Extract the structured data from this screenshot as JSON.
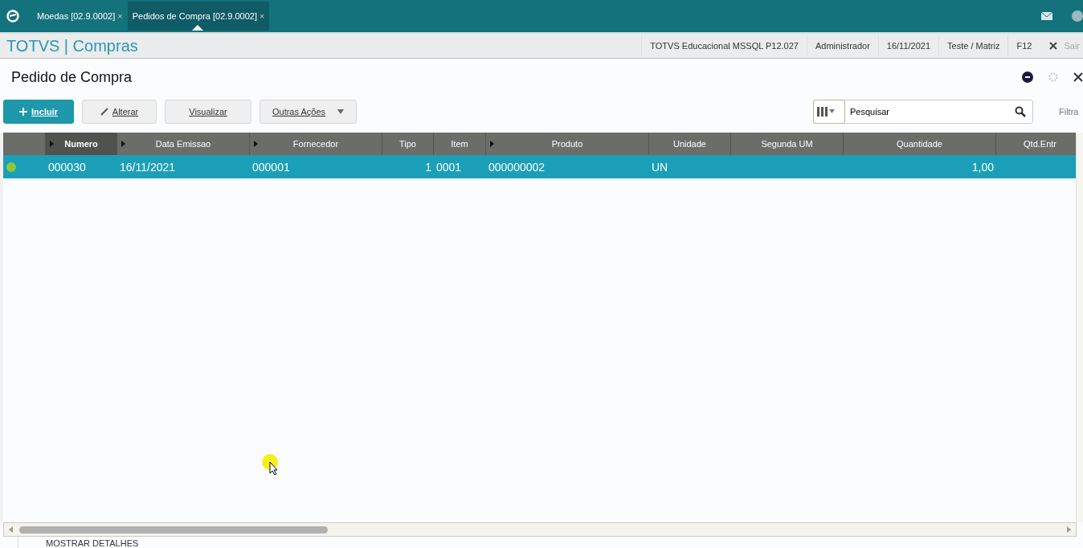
{
  "tabs": [
    {
      "label": "Moedas [02.9.0002]",
      "close": "×",
      "selected": false
    },
    {
      "label": "Pedidos de Compra [02.9.0002]",
      "close": "×",
      "selected": true
    }
  ],
  "header": {
    "brand": "TOTVS | Compras",
    "info": [
      "TOTVS Educacional MSSQL P12.027",
      "Administrador",
      "16/11/2021",
      "Teste / Matriz",
      "F12"
    ],
    "exit": "Sair"
  },
  "page_title": "Pedido de Compra",
  "toolbar": {
    "buttons": [
      {
        "label": "Incluir",
        "kind": "primary"
      },
      {
        "label": "Alterar",
        "kind": "edit"
      },
      {
        "label": "Visualizar",
        "kind": "plain"
      },
      {
        "label": "Outras Ações",
        "kind": "dropdown"
      }
    ],
    "search": {
      "placeholder": "Pesquisar"
    },
    "filter": "Filtra"
  },
  "table": {
    "columns": [
      {
        "label": "Numero",
        "arrow": true,
        "selected": true,
        "kind": "text"
      },
      {
        "label": "Data Emissao",
        "arrow": true,
        "selected": false,
        "kind": "text"
      },
      {
        "label": "Fornecedor",
        "arrow": true,
        "selected": false,
        "kind": "text"
      },
      {
        "label": "Tipo",
        "arrow": false,
        "selected": false,
        "kind": "number"
      },
      {
        "label": "Item",
        "arrow": false,
        "selected": false,
        "kind": "text"
      },
      {
        "label": "Produto",
        "arrow": true,
        "selected": false,
        "kind": "text"
      },
      {
        "label": "Unidade",
        "arrow": false,
        "selected": false,
        "kind": "text"
      },
      {
        "label": "Segunda UM",
        "arrow": false,
        "selected": false,
        "kind": "text"
      },
      {
        "label": "Quantidade",
        "arrow": false,
        "selected": false,
        "kind": "number"
      },
      {
        "label": "Qtd.Entr",
        "arrow": false,
        "selected": false,
        "kind": "text"
      }
    ],
    "rows": [
      {
        "color": "#8cc63f",
        "selected": true,
        "cells": [
          "000030",
          "16/11/2021",
          "000001",
          "1",
          "0001",
          "000000002",
          "UN",
          "",
          "1,00",
          ""
        ]
      }
    ]
  },
  "details_link": "MOSTRAR DETALHES"
}
